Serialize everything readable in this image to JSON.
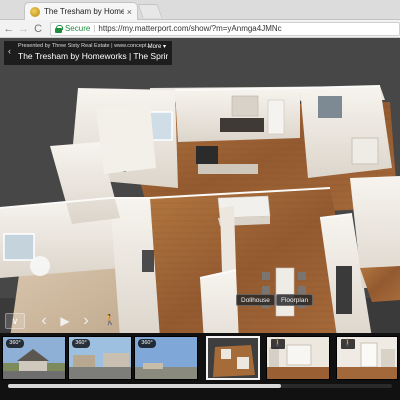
{
  "browser": {
    "tab_title": "The Tresham by Homeworks",
    "tab_close": "×",
    "back": "←",
    "forward": "→",
    "reload": "C",
    "secure_label": "Secure",
    "separator": "|",
    "url": "https://my.matterport.com/show/?m=yAnmga4JMNc"
  },
  "viewer": {
    "back_arrow": "‹",
    "presented_by": "Presented by Three Sixty Real Estate | www.concept...",
    "title": "The Tresham by Homeworks | The Sprin...",
    "more_button": "More ▾",
    "labels": {
      "dollhouse": "Dollhouse",
      "floorplan": "Floorplan"
    },
    "controls": {
      "collapse": "∨",
      "prev": "‹",
      "play": "▶",
      "next": "›",
      "walk": "🚶"
    },
    "filmstrip": [
      {
        "badge": "360°",
        "kind": "exterior"
      },
      {
        "badge": "360°",
        "kind": "exterior2"
      },
      {
        "badge": "360°",
        "kind": "sky"
      },
      {
        "badge": "",
        "kind": "dollhouse"
      },
      {
        "badge": "🚶",
        "kind": "interior"
      },
      {
        "badge": "🚶",
        "kind": "interior2"
      }
    ],
    "scroll_fraction": 0.71
  },
  "colors": {
    "secure_green": "#1e8e3e",
    "wall": "#f1ede6",
    "floor_wood": "#9c6438"
  }
}
